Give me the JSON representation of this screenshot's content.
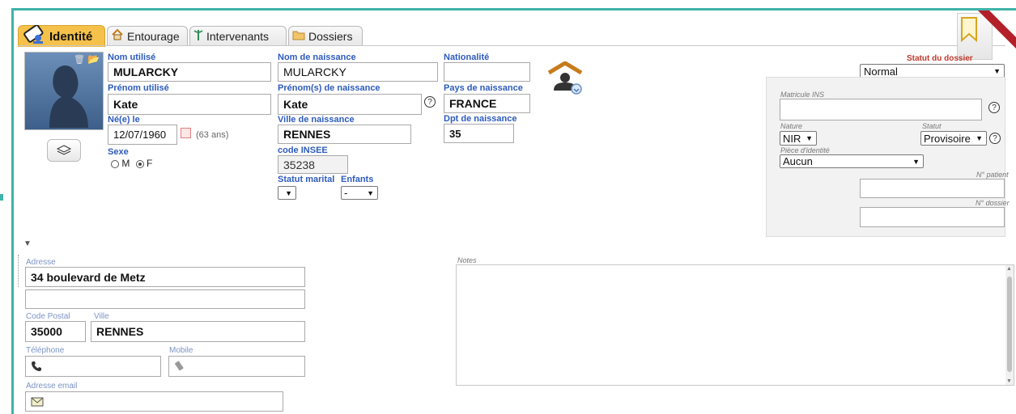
{
  "tabs": [
    {
      "label": "Identité",
      "icon": "id-card-icon"
    },
    {
      "label": "Entourage",
      "icon": "house-icon"
    },
    {
      "label": "Intervenants",
      "icon": "caduceus-icon"
    },
    {
      "label": "Dossiers",
      "icon": "folder-icon"
    }
  ],
  "identity": {
    "nom_utilise_label": "Nom utilisé",
    "nom_utilise": "MULARCKY",
    "prenom_utilise_label": "Prénom utilisé",
    "prenom_utilise": "Kate",
    "ne_le_label": "Né(e) le",
    "date_naissance": "12/07/1960",
    "age": "(63 ans)",
    "sexe_label": "Sexe",
    "sexe_m": "M",
    "sexe_f": "F",
    "sexe_selected": "F",
    "nom_naissance_label": "Nom de naissance",
    "nom_naissance": "MULARCKY",
    "prenoms_naissance_label": "Prénom(s) de naissance",
    "prenoms_naissance": "Kate",
    "ville_naissance_label": "Ville de naissance",
    "ville_naissance": "RENNES",
    "code_insee_label": "code INSEE",
    "code_insee": "35238",
    "statut_marital_label": "Statut marital",
    "statut_marital": "",
    "enfants_label": "Enfants",
    "enfants": "-",
    "nationalite_label": "Nationalité",
    "nationalite": "",
    "pays_naissance_label": "Pays de naissance",
    "pays_naissance": "FRANCE",
    "dpt_naissance_label": "Dpt de naissance",
    "dpt_naissance": "35",
    "help_symbol": "?"
  },
  "dossier": {
    "statut_label": "Statut du dossier",
    "statut": "Normal",
    "matricule_ins_label": "Matricule INS",
    "matricule_ins": "",
    "nature_label": "Nature",
    "nature": "NIR",
    "statut_ins_label": "Statut",
    "statut_ins": "Provisoire",
    "piece_identite_label": "Pièce d'identité",
    "piece_identite": "Aucun",
    "num_patient_label": "N° patient",
    "num_patient": "",
    "num_dossier_label": "N° dossier",
    "num_dossier": ""
  },
  "contact": {
    "adresse_label": "Adresse",
    "adresse1": "34 boulevard de Metz",
    "adresse2": "",
    "code_postal_label": "Code Postal",
    "code_postal": "35000",
    "ville_label": "Ville",
    "ville": "RENNES",
    "telephone_label": "Téléphone",
    "telephone": "",
    "mobile_label": "Mobile",
    "mobile": "",
    "email_label": "Adresse email",
    "email": "",
    "notes_label": "Notes",
    "notes": ""
  },
  "colors": {
    "frame": "#3fb3a8",
    "label_blue": "#2d5bbd",
    "active_tab": "#f5c14a",
    "status_red": "#c0392b"
  }
}
